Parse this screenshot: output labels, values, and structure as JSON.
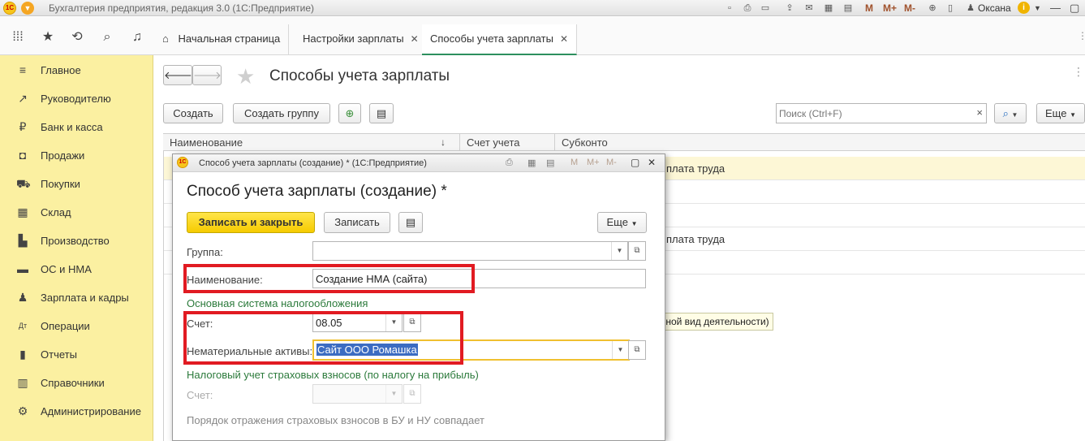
{
  "app": {
    "title": "Бухгалтерия предприятия, редакция 3.0  (1С:Предприятие)",
    "user": "Оксана",
    "logo_text": "1С",
    "toolbar_m": [
      "M",
      "M+",
      "M-"
    ]
  },
  "nav": {
    "tabs": [
      {
        "label": "Начальная страница",
        "icon": "home-icon"
      },
      {
        "label": "Настройки зарплаты",
        "close": "✕"
      },
      {
        "label": "Способы учета зарплаты",
        "close": "✕",
        "active": true
      }
    ]
  },
  "sidebar": {
    "items": [
      {
        "label": "Главное",
        "icon": "menu-lines-icon"
      },
      {
        "label": "Руководителю",
        "icon": "trend-icon"
      },
      {
        "label": "Банк и касса",
        "icon": "coin-icon"
      },
      {
        "label": "Продажи",
        "icon": "bag-icon"
      },
      {
        "label": "Покупки",
        "icon": "cart-icon"
      },
      {
        "label": "Склад",
        "icon": "grid-icon"
      },
      {
        "label": "Производство",
        "icon": "factory-icon"
      },
      {
        "label": "ОС и НМА",
        "icon": "truck-icon"
      },
      {
        "label": "Зарплата и кадры",
        "icon": "people-icon"
      },
      {
        "label": "Операции",
        "icon": "dt-kt-icon"
      },
      {
        "label": "Отчеты",
        "icon": "bar-chart-icon"
      },
      {
        "label": "Справочники",
        "icon": "book-icon"
      },
      {
        "label": "Администрирование",
        "icon": "gear-icon"
      }
    ]
  },
  "main": {
    "title": "Способы учета зарплаты",
    "create_label": "Создать",
    "create_group_label": "Создать группу",
    "search_placeholder": "Поиск (Ctrl+F)",
    "search_clear": "×",
    "more_label": "Еще",
    "columns": [
      "Наименование",
      "Счет учета",
      "Субконто"
    ],
    "rows": [
      {
        "subconto": "плата труда",
        "highlighted": true
      },
      {
        "subconto": ""
      },
      {
        "subconto": ""
      },
      {
        "subconto": "плата труда"
      },
      {
        "subconto": ""
      }
    ]
  },
  "dialog": {
    "window_title": "Способ учета зарплаты (создание) *  (1С:Предприятие)",
    "heading": "Способ учета зарплаты (создание) *",
    "save_close_label": "Записать и закрыть",
    "save_label": "Записать",
    "more_label": "Еще",
    "group_label": "Группа:",
    "group_value": "",
    "name_label": "Наименование:",
    "name_value": "Создание НМА (сайта)",
    "section1": "Основная система налогообложения",
    "account_label": "Счет:",
    "account_value": "08.05",
    "intangible_label": "Нематериальные активы:",
    "intangible_value": "Сайт ООО Ромашка",
    "section2": "Налоговый учет страховых взносов (по налогу на прибыль)",
    "account2_label": "Счет:",
    "account2_value": "",
    "footer_note": "Порядок отражения страховых взносов в БУ и НУ совпадает",
    "tooltip": "(основной вид деятельности)"
  },
  "colors": {
    "sidebar_bg": "#fbf0a1",
    "primary_button": "#f6cb00",
    "highlight_box": "#e11b22",
    "section_header": "#2b7a3b",
    "active_tab_underline": "#2d8f5e"
  }
}
